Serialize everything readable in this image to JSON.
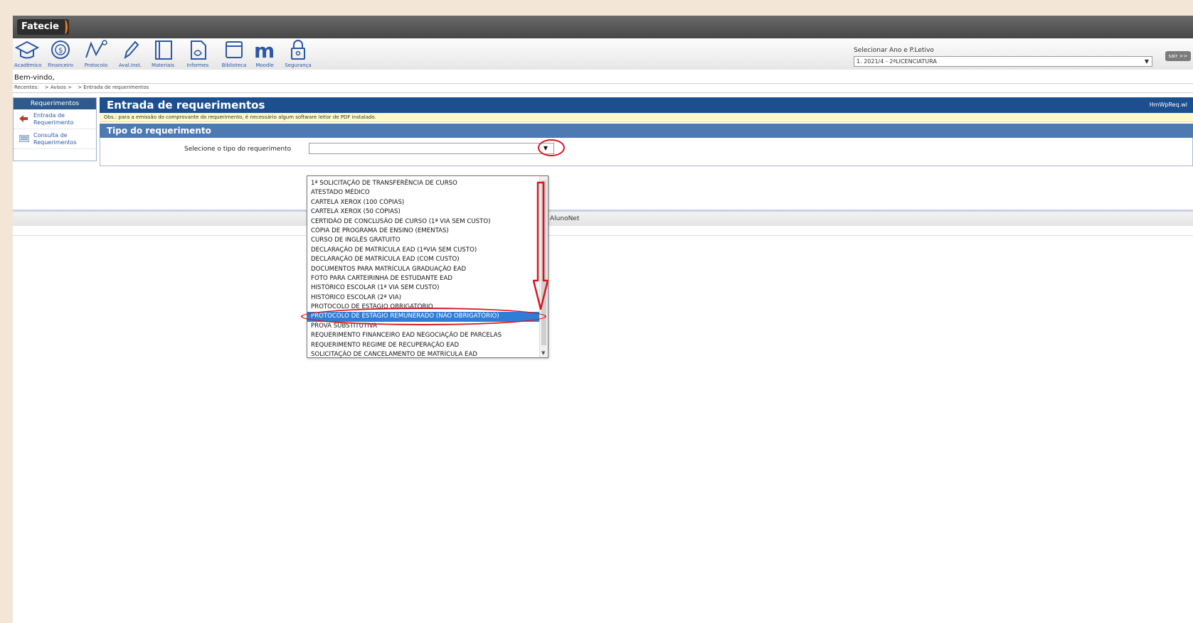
{
  "app": {
    "logo_text": "Fatecie",
    "welcome": "Bem-vindo,"
  },
  "menu": {
    "items": [
      {
        "label": "Acadêmico",
        "icon": "mortarboard-icon"
      },
      {
        "label": "Financeiro",
        "icon": "dollar-coin-icon"
      },
      {
        "label": "Protocolo",
        "icon": "line-graph-icon"
      },
      {
        "label": "Aval.Inst.",
        "icon": "pencil-icon"
      },
      {
        "label": "Materiais",
        "icon": "book-icon"
      },
      {
        "label": "Informes",
        "icon": "document-icon"
      },
      {
        "label": "Biblioteca",
        "icon": "window-icon"
      },
      {
        "label": "Moodle",
        "icon": "moodle-icon"
      },
      {
        "label": "Segurança",
        "icon": "lock-icon"
      }
    ]
  },
  "year": {
    "label": "Selecionar Ano e P.Letivo",
    "value": "1. 2021/4 - 2ªLICENCIATURA",
    "exit_label": "sair >>"
  },
  "breadcrumb": {
    "items": [
      "Recentes:",
      "> Avisos >",
      "> Entrada de requerimentos"
    ]
  },
  "sidebar": {
    "title": "Requerimentos",
    "items": [
      {
        "label": "Entrada de Requerimento",
        "icon": "arrow-entry-icon"
      },
      {
        "label": "Consulta de Requerimentos",
        "icon": "list-search-icon"
      }
    ]
  },
  "main": {
    "title": "Entrada de requerimentos",
    "code": "HmWpReq.wl",
    "notice": "Obs.: para a emissão do comprovante do requerimento, é necessário algum software leitor de PDF instalado.",
    "section_title": "Tipo do requerimento",
    "select_label": "Selecione o tipo do requerimento"
  },
  "footer": {
    "text": "AlunoNet"
  },
  "dropdown": {
    "selected_index": 14,
    "options": [
      "1ª SOLICITAÇÃO DE TRANSFERÊNCIA DE CURSO",
      "ATESTADO MÉDICO",
      "CARTELA XEROX (100 CÓPIAS)",
      "CARTELA XEROX (50 CÓPIAS)",
      "CERTIDÃO DE CONCLUSÃO DE CURSO (1ª VIA SEM CUSTO)",
      "CÓPIA DE PROGRAMA DE ENSINO (EMENTAS)",
      "CURSO DE INGLÊS GRATUITO",
      "DECLARAÇÃO DE MATRÍCULA EAD (1ªVIA SEM CUSTO)",
      "DECLARAÇÃO DE MATRÍCULA EAD (COM CUSTO)",
      "DOCUMENTOS PARA MATRÍCULA GRADUAÇÃO EAD",
      "FOTO PARA CARTEIRINHA DE ESTUDANTE EAD",
      "HISTÓRICO ESCOLAR (1ª VIA SEM CUSTO)",
      "HISTÓRICO ESCOLAR (2ª VIA)",
      "PROTOCOLO DE ESTÁGIO OBRIGATÓRIO",
      "PROTOCOLO DE ESTÁGIO REMUNERADO (NÃO OBRIGATÓRIO)",
      "PROVA SUBSTITUTIVA",
      "REQUERIMENTO FINANCEIRO EAD NEGOCIAÇÃO DE PARCELAS",
      "REQUERIMENTO REGIME DE RECUPERAÇÃO EAD",
      "SOLICITAÇÃO DE CANCELAMENTO DE MATRÍCULA EAD"
    ]
  },
  "colors": {
    "header_blue": "#1d4f8f",
    "section_blue": "#4d7ab3",
    "annotation_red": "#d8161e",
    "selection_blue": "#2f7dd6"
  }
}
